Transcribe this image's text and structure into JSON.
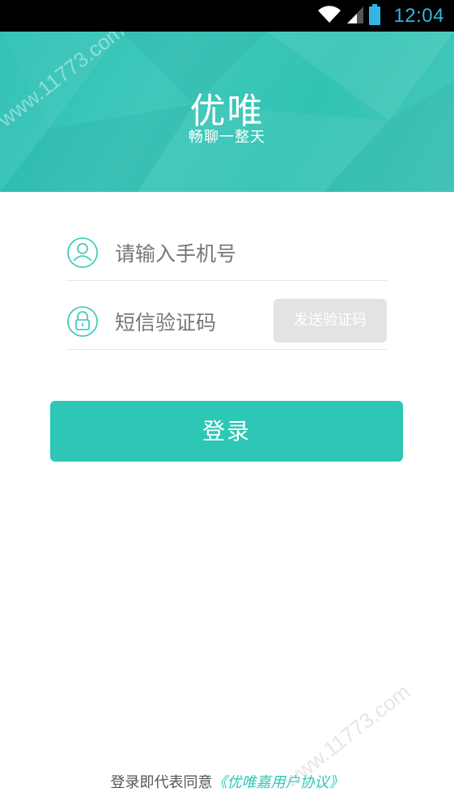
{
  "status_bar": {
    "time": "12:04",
    "icons": [
      "wifi-icon",
      "signal-icon",
      "battery-icon"
    ],
    "time_color": "#33b5e5"
  },
  "header": {
    "title": "优唯",
    "slogan": "畅聊一整天",
    "background_color": "#35c3b5"
  },
  "form": {
    "phone": {
      "icon": "user-icon",
      "placeholder": "请输入手机号",
      "value": ""
    },
    "code": {
      "icon": "lock-icon",
      "placeholder": "短信验证码",
      "value": "",
      "send_button_label": "发送验证码"
    }
  },
  "login_button": {
    "label": "登录",
    "color": "#2ec7b6"
  },
  "agreement": {
    "prefix": "登录即代表同意",
    "link": "《优唯嘉用户协议》"
  },
  "watermark": {
    "top": "www.11773.com",
    "bottom": "www.11773.com"
  }
}
